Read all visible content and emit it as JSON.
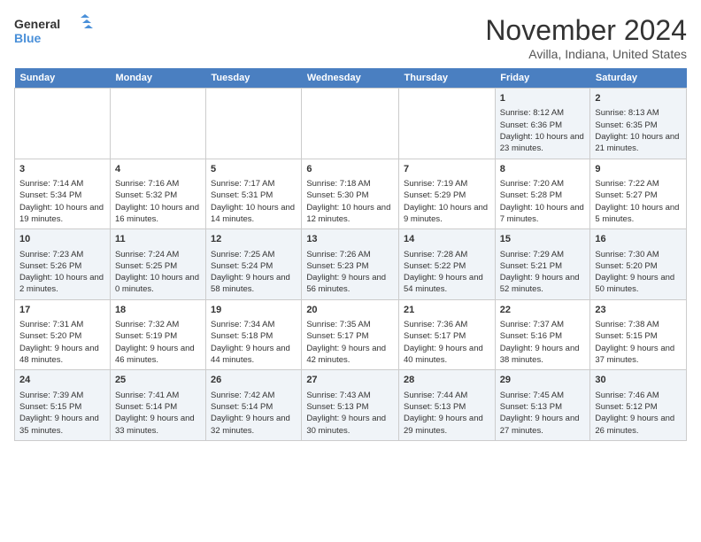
{
  "logo": {
    "line1": "General",
    "line2": "Blue"
  },
  "title": "November 2024",
  "location": "Avilla, Indiana, United States",
  "days_of_week": [
    "Sunday",
    "Monday",
    "Tuesday",
    "Wednesday",
    "Thursday",
    "Friday",
    "Saturday"
  ],
  "weeks": [
    [
      {
        "day": "",
        "content": ""
      },
      {
        "day": "",
        "content": ""
      },
      {
        "day": "",
        "content": ""
      },
      {
        "day": "",
        "content": ""
      },
      {
        "day": "",
        "content": ""
      },
      {
        "day": "1",
        "content": "Sunrise: 8:12 AM\nSunset: 6:36 PM\nDaylight: 10 hours and 23 minutes."
      },
      {
        "day": "2",
        "content": "Sunrise: 8:13 AM\nSunset: 6:35 PM\nDaylight: 10 hours and 21 minutes."
      }
    ],
    [
      {
        "day": "3",
        "content": "Sunrise: 7:14 AM\nSunset: 5:34 PM\nDaylight: 10 hours and 19 minutes."
      },
      {
        "day": "4",
        "content": "Sunrise: 7:16 AM\nSunset: 5:32 PM\nDaylight: 10 hours and 16 minutes."
      },
      {
        "day": "5",
        "content": "Sunrise: 7:17 AM\nSunset: 5:31 PM\nDaylight: 10 hours and 14 minutes."
      },
      {
        "day": "6",
        "content": "Sunrise: 7:18 AM\nSunset: 5:30 PM\nDaylight: 10 hours and 12 minutes."
      },
      {
        "day": "7",
        "content": "Sunrise: 7:19 AM\nSunset: 5:29 PM\nDaylight: 10 hours and 9 minutes."
      },
      {
        "day": "8",
        "content": "Sunrise: 7:20 AM\nSunset: 5:28 PM\nDaylight: 10 hours and 7 minutes."
      },
      {
        "day": "9",
        "content": "Sunrise: 7:22 AM\nSunset: 5:27 PM\nDaylight: 10 hours and 5 minutes."
      }
    ],
    [
      {
        "day": "10",
        "content": "Sunrise: 7:23 AM\nSunset: 5:26 PM\nDaylight: 10 hours and 2 minutes."
      },
      {
        "day": "11",
        "content": "Sunrise: 7:24 AM\nSunset: 5:25 PM\nDaylight: 10 hours and 0 minutes."
      },
      {
        "day": "12",
        "content": "Sunrise: 7:25 AM\nSunset: 5:24 PM\nDaylight: 9 hours and 58 minutes."
      },
      {
        "day": "13",
        "content": "Sunrise: 7:26 AM\nSunset: 5:23 PM\nDaylight: 9 hours and 56 minutes."
      },
      {
        "day": "14",
        "content": "Sunrise: 7:28 AM\nSunset: 5:22 PM\nDaylight: 9 hours and 54 minutes."
      },
      {
        "day": "15",
        "content": "Sunrise: 7:29 AM\nSunset: 5:21 PM\nDaylight: 9 hours and 52 minutes."
      },
      {
        "day": "16",
        "content": "Sunrise: 7:30 AM\nSunset: 5:20 PM\nDaylight: 9 hours and 50 minutes."
      }
    ],
    [
      {
        "day": "17",
        "content": "Sunrise: 7:31 AM\nSunset: 5:20 PM\nDaylight: 9 hours and 48 minutes."
      },
      {
        "day": "18",
        "content": "Sunrise: 7:32 AM\nSunset: 5:19 PM\nDaylight: 9 hours and 46 minutes."
      },
      {
        "day": "19",
        "content": "Sunrise: 7:34 AM\nSunset: 5:18 PM\nDaylight: 9 hours and 44 minutes."
      },
      {
        "day": "20",
        "content": "Sunrise: 7:35 AM\nSunset: 5:17 PM\nDaylight: 9 hours and 42 minutes."
      },
      {
        "day": "21",
        "content": "Sunrise: 7:36 AM\nSunset: 5:17 PM\nDaylight: 9 hours and 40 minutes."
      },
      {
        "day": "22",
        "content": "Sunrise: 7:37 AM\nSunset: 5:16 PM\nDaylight: 9 hours and 38 minutes."
      },
      {
        "day": "23",
        "content": "Sunrise: 7:38 AM\nSunset: 5:15 PM\nDaylight: 9 hours and 37 minutes."
      }
    ],
    [
      {
        "day": "24",
        "content": "Sunrise: 7:39 AM\nSunset: 5:15 PM\nDaylight: 9 hours and 35 minutes."
      },
      {
        "day": "25",
        "content": "Sunrise: 7:41 AM\nSunset: 5:14 PM\nDaylight: 9 hours and 33 minutes."
      },
      {
        "day": "26",
        "content": "Sunrise: 7:42 AM\nSunset: 5:14 PM\nDaylight: 9 hours and 32 minutes."
      },
      {
        "day": "27",
        "content": "Sunrise: 7:43 AM\nSunset: 5:13 PM\nDaylight: 9 hours and 30 minutes."
      },
      {
        "day": "28",
        "content": "Sunrise: 7:44 AM\nSunset: 5:13 PM\nDaylight: 9 hours and 29 minutes."
      },
      {
        "day": "29",
        "content": "Sunrise: 7:45 AM\nSunset: 5:13 PM\nDaylight: 9 hours and 27 minutes."
      },
      {
        "day": "30",
        "content": "Sunrise: 7:46 AM\nSunset: 5:12 PM\nDaylight: 9 hours and 26 minutes."
      }
    ]
  ]
}
